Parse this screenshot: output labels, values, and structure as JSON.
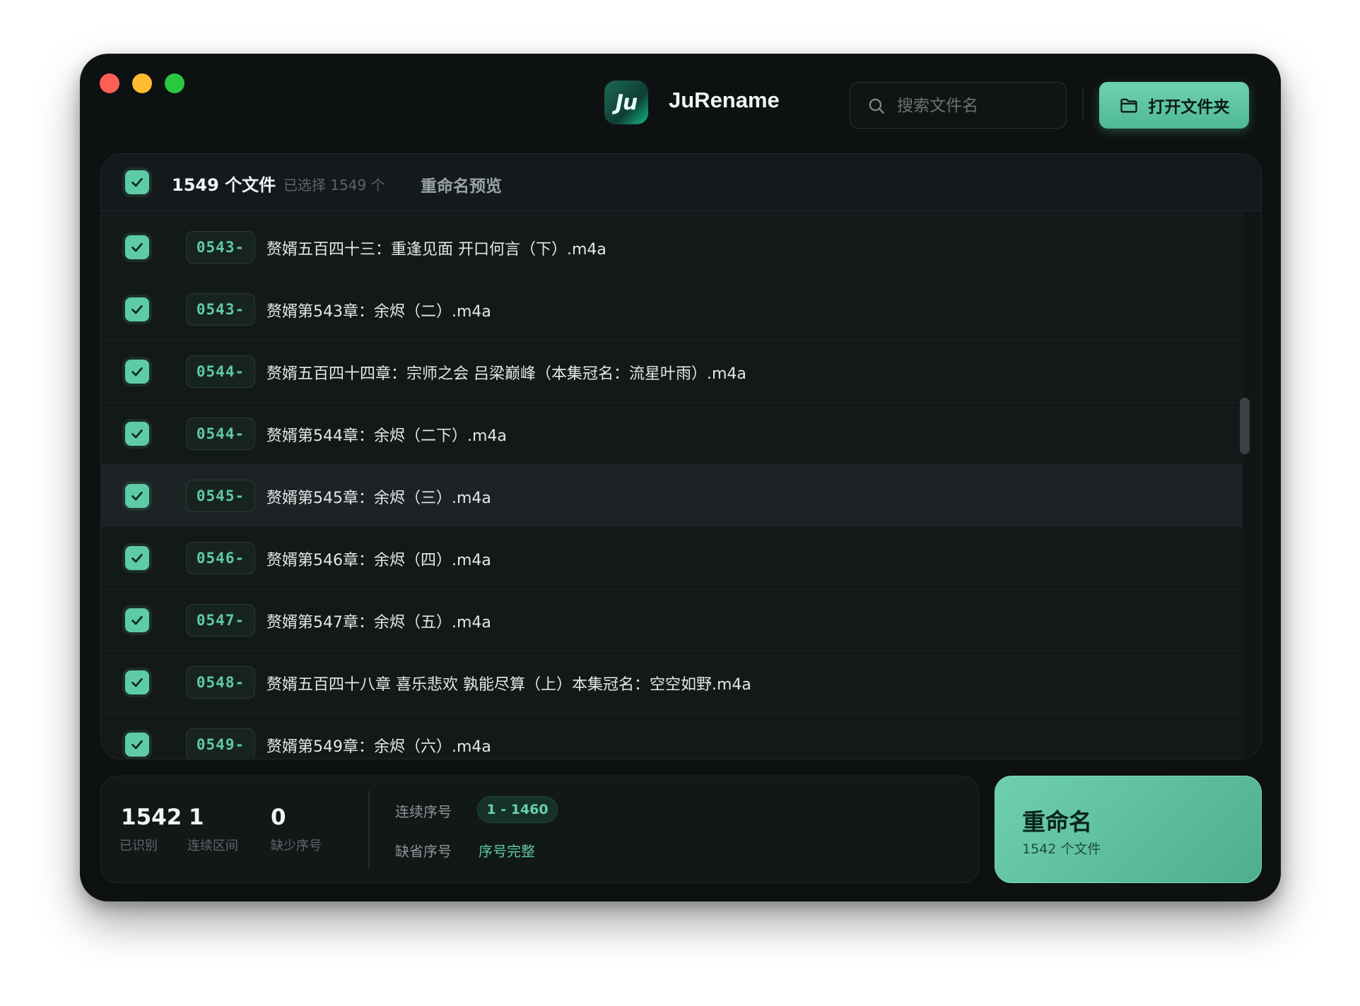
{
  "app": {
    "title": "JuRename",
    "logo_text": "Ju"
  },
  "search": {
    "placeholder": "搜索文件名",
    "value": ""
  },
  "toolbar": {
    "open_folder_label": "打开文件夹"
  },
  "list": {
    "file_count": "1549 个文件",
    "selected_count": "已选择 1549 个",
    "preview_title": "重命名预览",
    "rows": [
      {
        "num": "0543-",
        "name": "赘婿五百四十三：重逢见面 开口何言（下）.m4a",
        "checked": true
      },
      {
        "num": "0543-",
        "name": "赘婿第543章：余烬（二）.m4a",
        "checked": true
      },
      {
        "num": "0544-",
        "name": "赘婿五百四十四章：宗师之会 吕梁巅峰（本集冠名：流星叶雨）.m4a",
        "checked": true
      },
      {
        "num": "0544-",
        "name": "赘婿第544章：余烬（二下）.m4a",
        "checked": true
      },
      {
        "num": "0545-",
        "name": "赘婿第545章：余烬（三）.m4a",
        "checked": true
      },
      {
        "num": "0546-",
        "name": "赘婿第546章：余烬（四）.m4a",
        "checked": true
      },
      {
        "num": "0547-",
        "name": "赘婿第547章：余烬（五）.m4a",
        "checked": true
      },
      {
        "num": "0548-",
        "name": "赘婿五百四十八章 喜乐悲欢 孰能尽算（上）本集冠名：空空如野.m4a",
        "checked": true
      },
      {
        "num": "0549-",
        "name": "赘婿第549章：余烬（六）.m4a",
        "checked": true
      }
    ]
  },
  "stats": {
    "recognized_value": "1542",
    "recognized_label": "已识别",
    "ranges_value": "1",
    "ranges_label": "连续区间",
    "missing_value": "0",
    "missing_label": "缺少序号",
    "sequence_label": "连续序号",
    "sequence_range": "1 - 1460",
    "missing_seq_label": "缺省序号",
    "missing_seq_status": "序号完整"
  },
  "rename": {
    "title": "重命名",
    "subtitle": "1542 个文件"
  },
  "colors": {
    "accent": "#5ecba7",
    "window_bg": "#0e1112",
    "panel_bg": "#131819"
  }
}
